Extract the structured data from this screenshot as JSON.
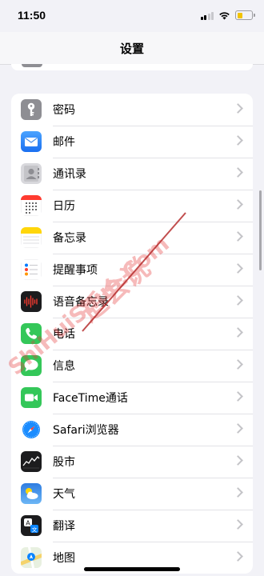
{
  "status": {
    "time": "11:50",
    "battery_level": 0.4
  },
  "nav": {
    "title": "设置"
  },
  "settings": [
    {
      "label": "密码",
      "icon": "key-icon",
      "color": "#8e8e93"
    },
    {
      "label": "邮件",
      "icon": "mail-icon",
      "color": "#3478f6"
    },
    {
      "label": "通讯录",
      "icon": "contacts-icon",
      "color": "#a4a4a8"
    },
    {
      "label": "日历",
      "icon": "calendar-icon",
      "color": "#ffffff"
    },
    {
      "label": "备忘录",
      "icon": "notes-icon",
      "color": "#ffd60a"
    },
    {
      "label": "提醒事项",
      "icon": "reminders-icon",
      "color": "#ffffff"
    },
    {
      "label": "语音备忘录",
      "icon": "voice-memos-icon",
      "color": "#1c1c1e"
    },
    {
      "label": "电话",
      "icon": "phone-icon",
      "color": "#34c759"
    },
    {
      "label": "信息",
      "icon": "messages-icon",
      "color": "#34c759"
    },
    {
      "label": "FaceTime通话",
      "icon": "facetime-icon",
      "color": "#34c759"
    },
    {
      "label": "Safari浏览器",
      "icon": "safari-icon",
      "color": "#1a8cff"
    },
    {
      "label": "股市",
      "icon": "stocks-icon",
      "color": "#1c1c1e"
    },
    {
      "label": "天气",
      "icon": "weather-icon",
      "color": "#3a8ee6"
    },
    {
      "label": "翻译",
      "icon": "translate-icon",
      "color": "#1c1c1e"
    },
    {
      "label": "地图",
      "icon": "maps-icon",
      "color": "#e8f0e0"
    }
  ],
  "watermark": {
    "text_cn": "适会说",
    "text_en": "ShiHuiShuo.Com"
  }
}
